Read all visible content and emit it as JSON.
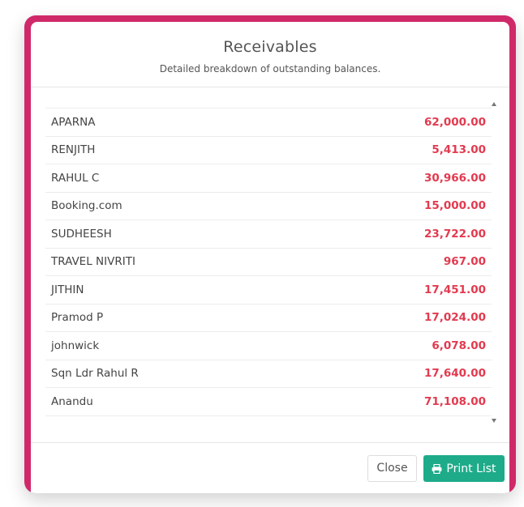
{
  "modal": {
    "title": "Receivables",
    "subtitle": "Detailed breakdown of outstanding balances."
  },
  "receivables": [
    {
      "name": "APARNA",
      "amount": "62,000.00"
    },
    {
      "name": "RENJITH",
      "amount": "5,413.00"
    },
    {
      "name": "RAHUL C",
      "amount": "30,966.00"
    },
    {
      "name": "Booking.com",
      "amount": "15,000.00"
    },
    {
      "name": "SUDHEESH",
      "amount": "23,722.00"
    },
    {
      "name": "TRAVEL NIVRITI",
      "amount": "967.00"
    },
    {
      "name": "JITHIN",
      "amount": "17,451.00"
    },
    {
      "name": "Pramod P",
      "amount": "17,024.00"
    },
    {
      "name": "johnwick",
      "amount": "6,078.00"
    },
    {
      "name": "Sqn Ldr Rahul R",
      "amount": "17,640.00"
    },
    {
      "name": "Anandu",
      "amount": "71,108.00"
    }
  ],
  "footer": {
    "close_label": "Close",
    "print_label": "Print List",
    "print_icon": "print-icon"
  },
  "colors": {
    "frame_accent": "#d0296a",
    "amount_red": "#e23a4f",
    "print_button": "#1eab8a"
  }
}
